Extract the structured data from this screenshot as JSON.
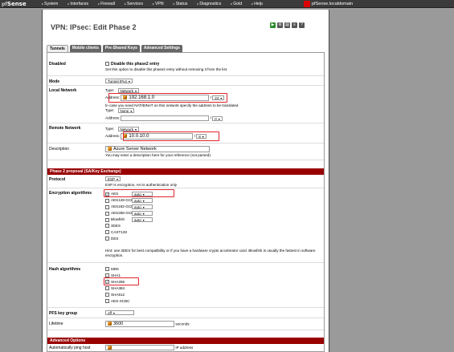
{
  "topbar": {
    "logo_text": "Sense",
    "logo_prefix": "pf",
    "menu": [
      "System",
      "Interfaces",
      "Firewall",
      "Services",
      "VPN",
      "Status",
      "Diagnostics",
      "Gold",
      "Help"
    ],
    "hostname": "pfSense.localdomain"
  },
  "page": {
    "title": "VPN: IPsec: Edit Phase 2"
  },
  "tabs": [
    "Tunnels",
    "Mobile clients",
    "Pre-Shared Keys",
    "Advanced Settings"
  ],
  "form": {
    "disabled": {
      "label": "Disabled",
      "checkbox_label": "Disable this phase2 entry",
      "help": "Set this option to disable this phase2 entry without removing it from the list."
    },
    "mode": {
      "label": "Mode",
      "value": "Tunnel IPv4"
    },
    "local_network": {
      "label": "Local Network",
      "type_label": "Type:",
      "type_value": "Network",
      "address_label": "Address:",
      "address_value": "192.168.1.0",
      "mask": "24",
      "nat_help": "In case you need NAT/BINAT on this network specify the address to be translated",
      "nat_type_label": "Type:",
      "nat_type_value": "None",
      "nat_address_label": "Address:",
      "nat_mask": "0"
    },
    "remote_network": {
      "label": "Remote Network",
      "type_label": "Type:",
      "type_value": "Network",
      "address_label": "Address:",
      "address_value": "10.0.10.0",
      "mask": "8"
    },
    "description": {
      "label": "Description",
      "value": "Azure Server Network",
      "help": "You may enter a description here for your reference (not parsed)."
    },
    "phase2_header": "Phase 2 proposal (SA/Key Exchange)",
    "protocol": {
      "label": "Protocol",
      "value": "ESP",
      "help": "ESP is encryption, AH is authentication only"
    },
    "encryption": {
      "label": "Encryption algorithms",
      "items": [
        {
          "name": "AES",
          "checked": true,
          "keylen": "auto"
        },
        {
          "name": "AES128-GCM",
          "checked": false,
          "keylen": "auto"
        },
        {
          "name": "AES192-GCM",
          "checked": false,
          "keylen": "auto"
        },
        {
          "name": "AES256-GCM",
          "checked": false,
          "keylen": "auto"
        },
        {
          "name": "Blowfish",
          "checked": false,
          "keylen": "auto"
        },
        {
          "name": "3DES",
          "checked": false,
          "keylen": ""
        },
        {
          "name": "CAST128",
          "checked": false,
          "keylen": ""
        },
        {
          "name": "DES",
          "checked": false,
          "keylen": ""
        }
      ],
      "hint": "Hint: use 3DES for best compatibility or if you have a hardware crypto accelerator card. Blowfish is usually the fastest in software encryption."
    },
    "hash": {
      "label": "Hash algorithms",
      "items": [
        {
          "name": "MD5",
          "checked": false
        },
        {
          "name": "SHA1",
          "checked": false
        },
        {
          "name": "SHA256",
          "checked": true
        },
        {
          "name": "SHA384",
          "checked": false
        },
        {
          "name": "SHA512",
          "checked": false
        },
        {
          "name": "AES-XCBC",
          "checked": false
        }
      ]
    },
    "pfs": {
      "label": "PFS key group",
      "value": "off"
    },
    "lifetime": {
      "label": "Lifetime",
      "value": "3600",
      "unit": "seconds"
    },
    "advanced_header": "Advanced Options",
    "ping_host": {
      "label": "Automatically ping host",
      "unit": "IP address"
    }
  },
  "colors": {
    "accent": "#990000",
    "highlight": "#e0242b"
  }
}
